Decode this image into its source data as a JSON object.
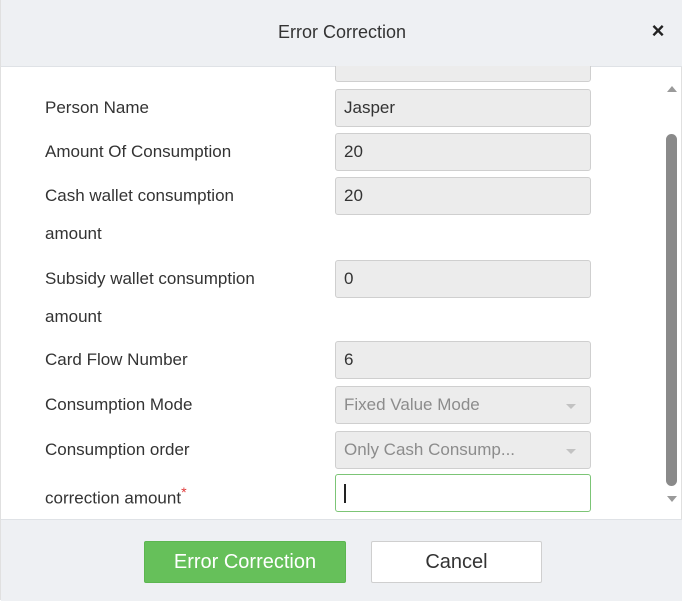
{
  "dialog": {
    "title": "Error Correction",
    "close_glyph": "×"
  },
  "form": {
    "person_name_label": "Person Name",
    "person_name_value": "Jasper",
    "amount_label": "Amount Of Consumption",
    "amount_value": "20",
    "cash_label_line1": "Cash wallet consumption",
    "cash_label_line2": "amount",
    "cash_value": "20",
    "subsidy_label_line1": "Subsidy wallet consumption",
    "subsidy_label_line2": "amount",
    "subsidy_value": "0",
    "card_flow_label": "Card Flow Number",
    "card_flow_value": "6",
    "mode_label": "Consumption Mode",
    "mode_value": "Fixed Value Mode",
    "order_label": "Consumption order",
    "order_value": "Only Cash Consump...",
    "correction_label": "correction amount",
    "required_mark": "*",
    "correction_value": ""
  },
  "footer": {
    "confirm_label": "Error Correction",
    "cancel_label": "Cancel"
  },
  "colors": {
    "primary": "#66c05a",
    "required": "#e03a3a",
    "header_bg": "#eef0f3",
    "field_bg": "#ececec"
  }
}
